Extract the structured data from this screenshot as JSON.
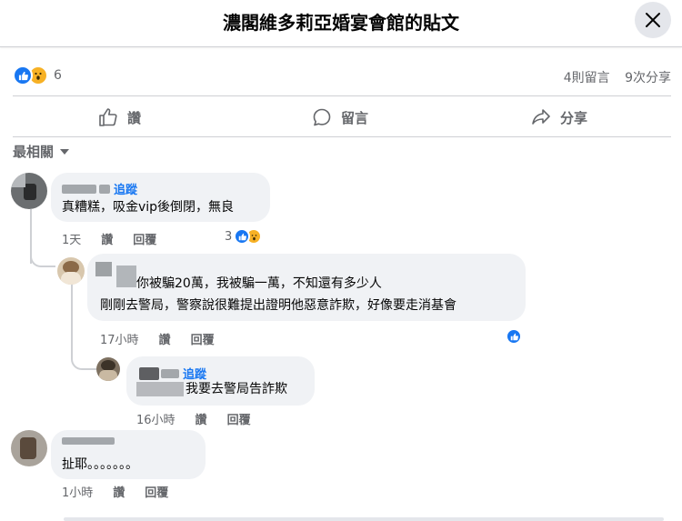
{
  "header": {
    "title": "濃閣維多莉亞婚宴會館的貼文"
  },
  "colors": {
    "accent": "#1877f2",
    "bubble": "#f0f2f5",
    "secondary_text": "#65676b",
    "wow": "#f7b125"
  },
  "stats": {
    "reaction_count": "6",
    "comments": "4則留言",
    "shares": "9次分享",
    "reaction_icons": [
      "like-icon",
      "wow-icon"
    ]
  },
  "actions": {
    "like": "讚",
    "comment": "留言",
    "share": "分享"
  },
  "sort": {
    "label": "最相關"
  },
  "comments": [
    {
      "follow": "追蹤",
      "text": "真糟糕，吸金vip後倒閉，無良",
      "time": "1天",
      "like": "讚",
      "reply": "回覆",
      "reaction_count": "3"
    },
    {
      "text_line1": "你被騙20萬，我被騙一萬，不知還有多少人",
      "text_line2": "剛剛去警局，警察說很難提出證明他惡意詐欺，好像要走消基會",
      "time": "17小時",
      "like": "讚",
      "reply": "回覆"
    },
    {
      "follow": "追蹤",
      "text": "我要去警局告詐欺",
      "time": "16小時",
      "like": "讚",
      "reply": "回覆"
    },
    {
      "text": "扯耶。。。。。。。",
      "time": "1小時",
      "like": "讚",
      "reply": "回覆"
    }
  ]
}
